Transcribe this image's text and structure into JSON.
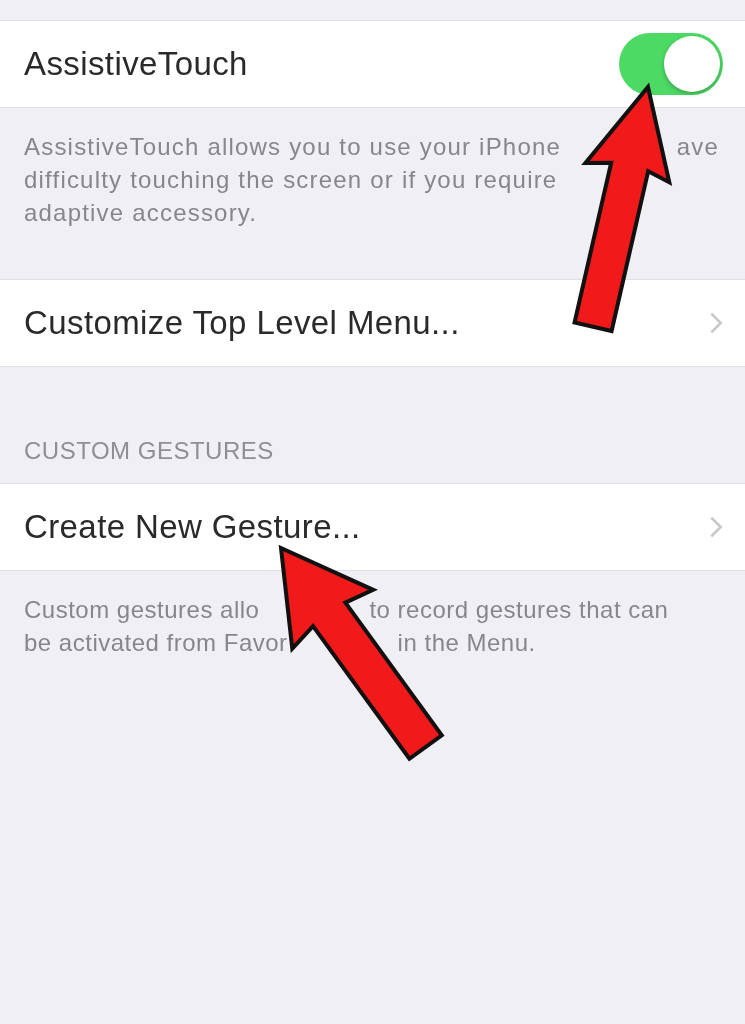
{
  "assistive_touch": {
    "label": "AssistiveTouch",
    "on": true
  },
  "assistive_touch_footer": [
    [
      "AssistiveTouch allows you to use your iPhone",
      "ave"
    ],
    [
      "difficulty touching the screen or if you require"
    ],
    [
      "adaptive accessory."
    ]
  ],
  "menu_row": {
    "label": "Customize Top Level Menu..."
  },
  "custom_gestures": {
    "header": "CUSTOM GESTURES",
    "row": {
      "label": "Create New Gesture..."
    },
    "footer": [
      [
        "Custom gestures allo",
        "to record gestures that can"
      ],
      [
        "be activated from Favor",
        "in the Menu."
      ]
    ]
  }
}
